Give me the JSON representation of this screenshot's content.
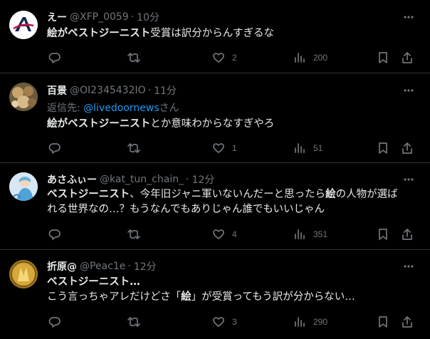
{
  "tweets": [
    {
      "display_name": "えー",
      "handle": "@XFP_0059",
      "separator": "·",
      "time": "10分",
      "body_bold": "絵がベストジーニスト",
      "body_rest": "受賞は訳分からんすぎるな",
      "replies": "",
      "retweets": "",
      "likes": "2",
      "views": "200"
    },
    {
      "display_name": "百景",
      "handle": "@OI2345432IO",
      "separator": "·",
      "time": "11分",
      "reply_prefix": "返信先: ",
      "reply_mention": "@livedoornews",
      "reply_suffix": "さん",
      "body_bold": "絵がベストジーニスト",
      "body_rest": "とか意味わからなすぎやろ",
      "replies": "",
      "retweets": "",
      "likes": "1",
      "views": "51"
    },
    {
      "display_name": "あさふぃー",
      "handle": "@kat_tun_chain_",
      "separator": "·",
      "time": "12分",
      "body_line1_bold": "ベストジーニスト",
      "body_line1_rest": "、今年旧ジャニ軍いないんだーと思ったら",
      "body_line1_bold2": "絵",
      "body_line1_rest2": "の人物が選ば",
      "body_line2": "れる世界なの…？もうなんでもありじゃん誰でもいいじゃん",
      "replies": "",
      "retweets": "",
      "likes": "4",
      "views": "351"
    },
    {
      "display_name": "折原@",
      "handle": "@Peac1e",
      "separator": "·",
      "time": "12分",
      "body_line1_bold": "ベストジーニスト…",
      "body_line2_a": "こう言っちゃアレだけどさ「",
      "body_line2_bold": "絵",
      "body_line2_b": "」が受賞ってもう訳が分からない…",
      "replies": "",
      "retweets": "",
      "likes": "3",
      "views": "290"
    }
  ],
  "colors": {
    "background": "#000000",
    "text_primary": "#e7e9ea",
    "text_secondary": "#71767b",
    "link": "#1d9bf0",
    "divider": "#2f3336"
  },
  "icons": {
    "more": "more-dots-icon",
    "reply": "reply-icon",
    "retweet": "retweet-icon",
    "like": "heart-icon",
    "views": "views-chart-icon",
    "bookmark": "bookmark-icon",
    "share": "share-icon"
  }
}
